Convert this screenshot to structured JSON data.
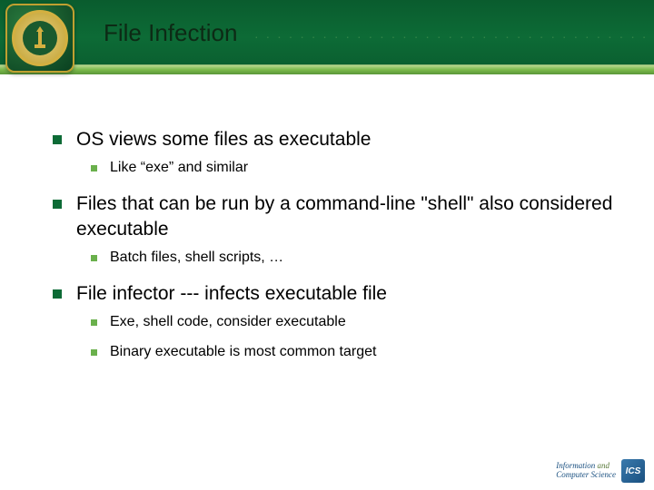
{
  "header": {
    "title": "File Infection"
  },
  "content": {
    "items": [
      {
        "text": "OS views some files as executable",
        "sub": [
          {
            "text": "Like “exe” and similar"
          }
        ]
      },
      {
        "text": "Files that can be run by a command-line \"shell\" also considered executable",
        "sub": [
          {
            "text": "Batch files, shell scripts, …"
          }
        ]
      },
      {
        "text": "File infector --- infects executable file",
        "sub": [
          {
            "text": "Exe, shell code, consider executable"
          },
          {
            "text": "Binary executable is most common target"
          }
        ]
      }
    ]
  },
  "footer": {
    "line1": "Information",
    "joiner": "and",
    "line2": "Computer Science",
    "badge": "ICS"
  }
}
